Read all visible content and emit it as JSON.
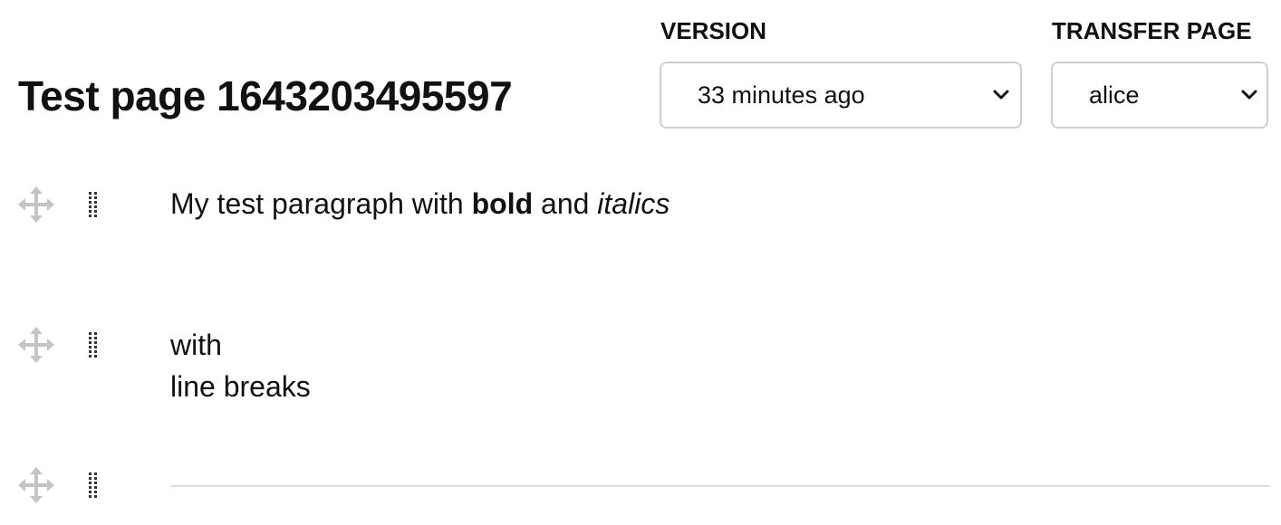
{
  "page": {
    "title": "Test page 1643203495597"
  },
  "version": {
    "label": "VERSION",
    "selected": "33 minutes ago"
  },
  "transfer": {
    "label": "TRANSFER PAGE",
    "selected": "alice"
  },
  "blocks": [
    {
      "type": "paragraph",
      "parts": [
        {
          "text": "My test paragraph with ",
          "style": "normal"
        },
        {
          "text": "bold",
          "style": "bold"
        },
        {
          "text": " and ",
          "style": "normal"
        },
        {
          "text": "italics",
          "style": "italic"
        }
      ]
    },
    {
      "type": "paragraph",
      "lines": [
        "with",
        "line breaks"
      ]
    },
    {
      "type": "divider"
    }
  ],
  "icons": {
    "move": "move-arrows-icon",
    "drag": "drag-dots-icon",
    "select": "chevron-down-icon"
  },
  "colors": {
    "text": "#111111",
    "handle_move": "#c4c4c4",
    "handle_drag": "#333333",
    "select_border": "#cfcfcf",
    "divider": "#dcdcdc"
  }
}
